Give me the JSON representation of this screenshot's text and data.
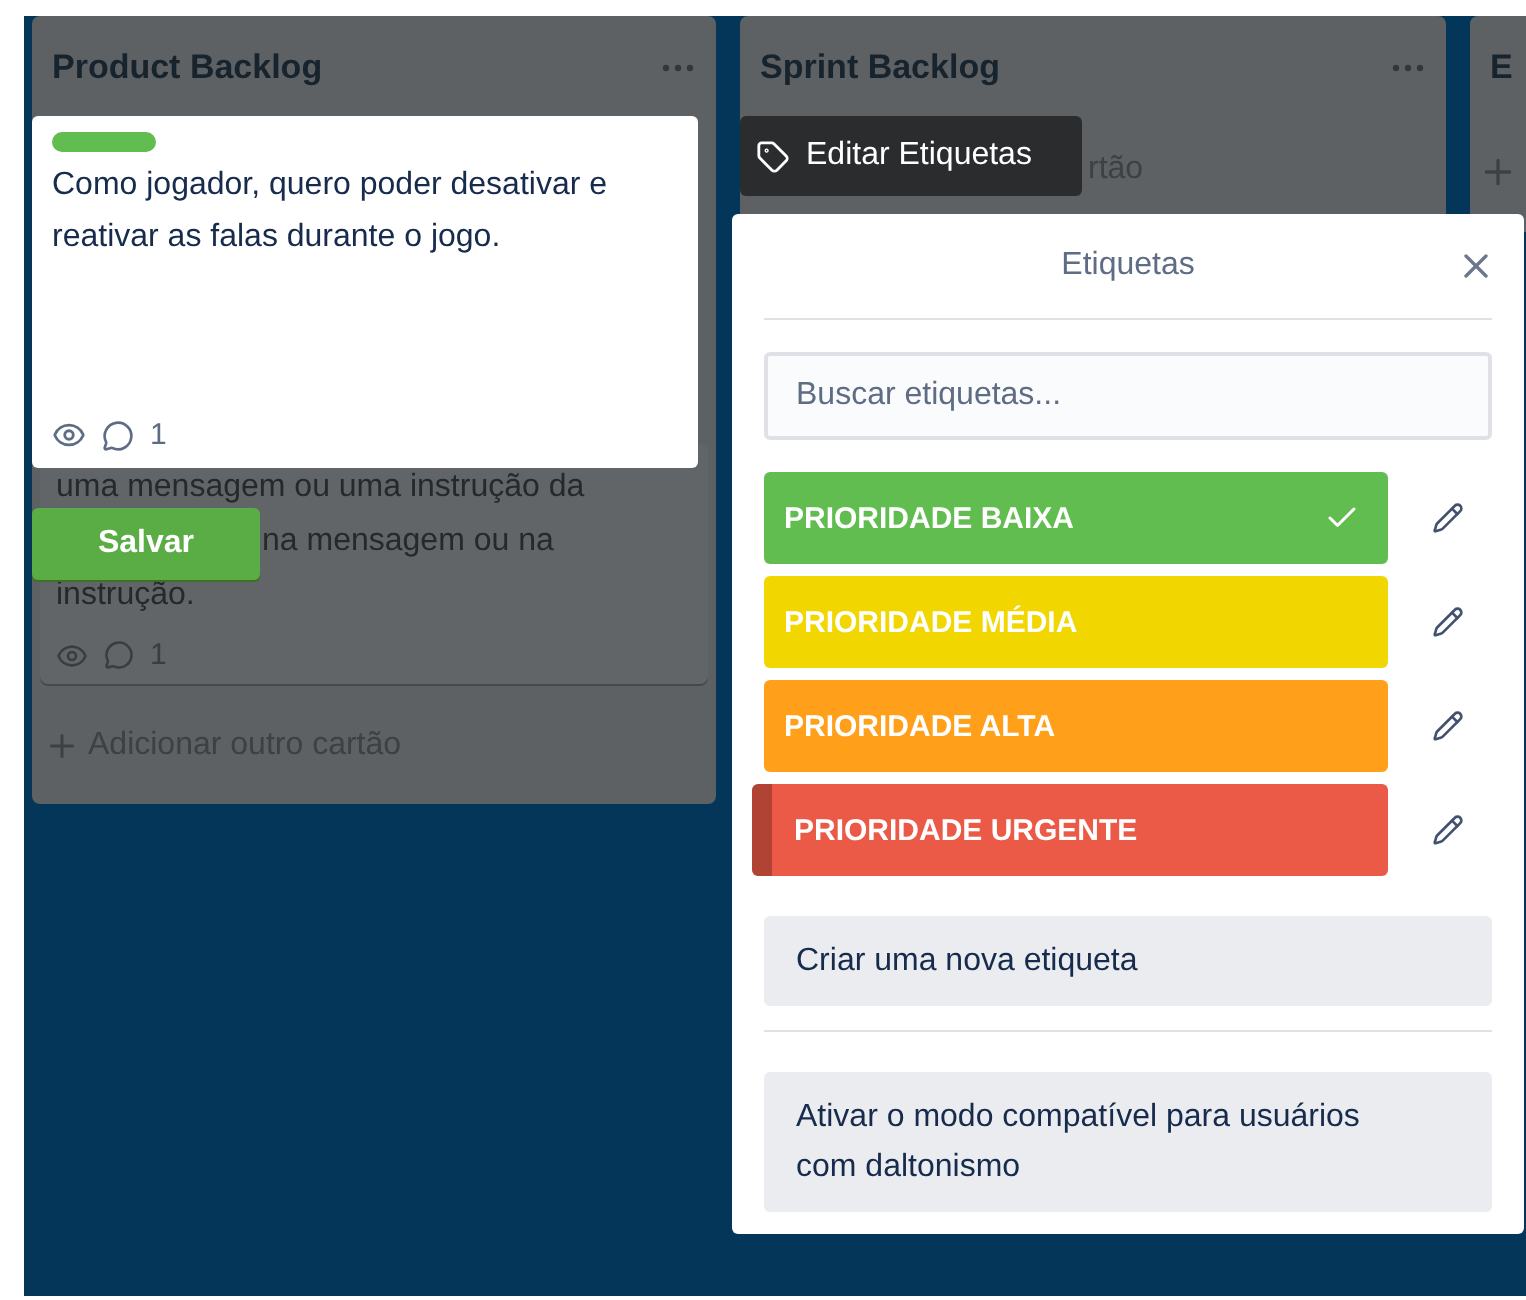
{
  "board": {
    "lists": [
      {
        "title": "Product Backlog",
        "cards": [
          {
            "lines": [
              "uma mensagem ou uma instrução da",
              "na mensagem ou na",
              "instrução."
            ],
            "comments": "1"
          }
        ],
        "add_card": "Adicionar outro cartão"
      },
      {
        "title": "Sprint Backlog",
        "add_card": "rtão"
      },
      {
        "title": "E"
      }
    ]
  },
  "quick_edit": {
    "labels": [
      {
        "color": "#61bd4f"
      }
    ],
    "text": "Como jogador, quero poder desativar e reativar as falas durante o jogo.",
    "comments": "1",
    "save": "Salvar"
  },
  "tooltip": {
    "label": "Editar Etiquetas"
  },
  "labels_popover": {
    "title": "Etiquetas",
    "search": {
      "placeholder": "Buscar etiquetas..."
    },
    "labels": [
      {
        "name": "PRIORIDADE BAIXA",
        "color": "#61bd4f",
        "selected": true,
        "hovered": false
      },
      {
        "name": "PRIORIDADE MÉDIA",
        "color": "#f2d600",
        "selected": false,
        "hovered": false
      },
      {
        "name": "PRIORIDADE ALTA",
        "color": "#ff9f1a",
        "selected": false,
        "hovered": false
      },
      {
        "name": "PRIORIDADE URGENTE",
        "color": "#eb5a46",
        "selected": false,
        "hovered": true
      }
    ],
    "create": "Criar uma nova etiqueta",
    "colorblind": "Ativar o modo compatível para usuários com daltonismo"
  }
}
